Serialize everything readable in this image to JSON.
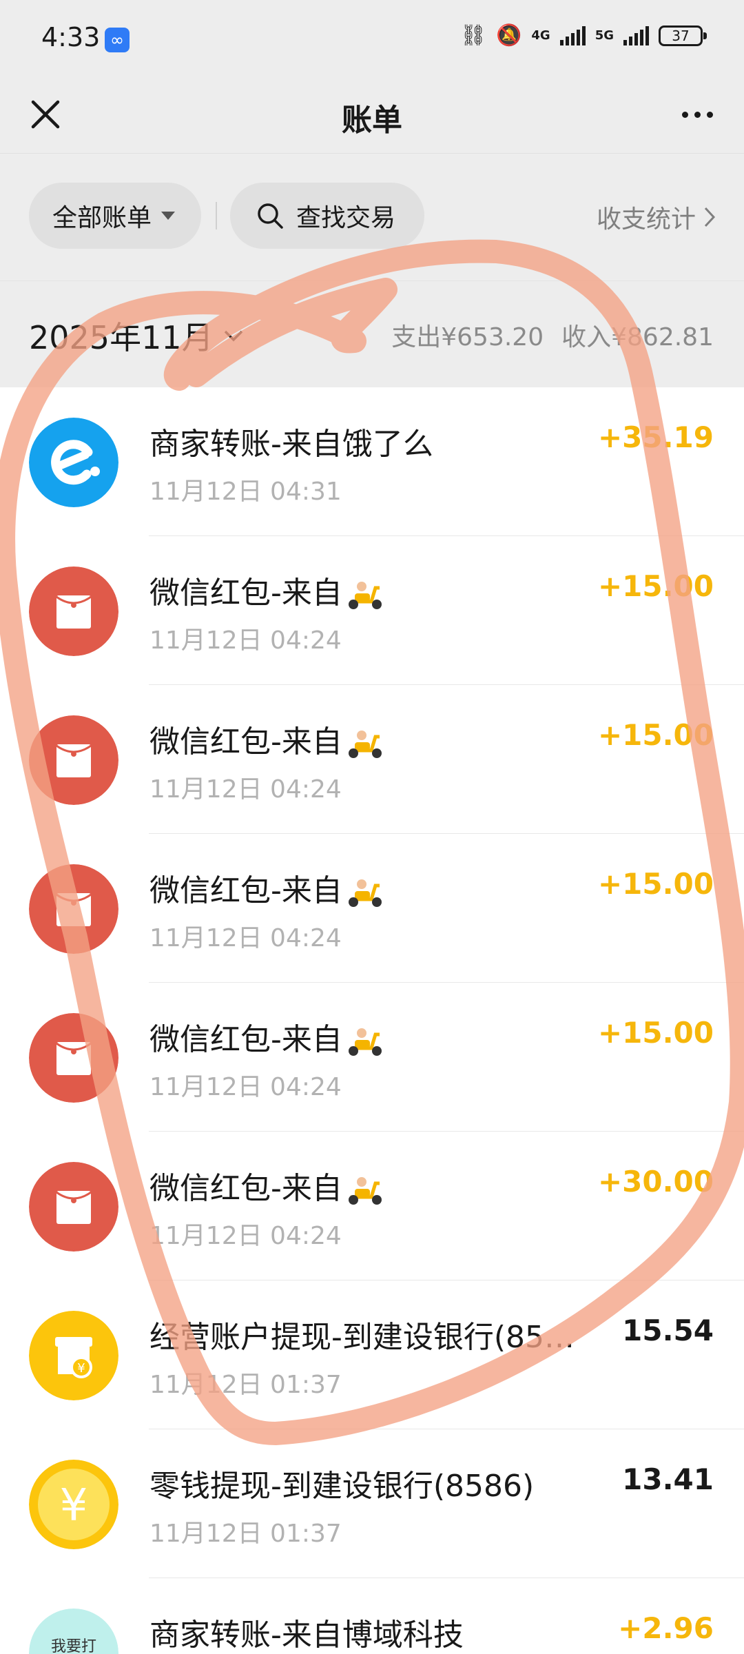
{
  "status_bar": {
    "time": "4:33",
    "battery": "37",
    "net1": "4G",
    "net2": "5G"
  },
  "nav": {
    "title": "账单"
  },
  "filters": {
    "all_bills": "全部账单",
    "search": "查找交易",
    "stats": "收支统计"
  },
  "month_bar": {
    "month": "2025年11月",
    "expense": "支出¥653.20",
    "income": "收入¥862.81"
  },
  "transactions": [
    {
      "title": "商家转账-来自饿了么",
      "time": "11月12日 04:31",
      "amount": "+35.19",
      "type": "income",
      "icon": "eleme-icon"
    },
    {
      "title": "微信红包-来自",
      "time": "11月12日 04:24",
      "amount": "+15.00",
      "type": "income",
      "icon": "red-packet-icon"
    },
    {
      "title": "微信红包-来自",
      "time": "11月12日 04:24",
      "amount": "+15.00",
      "type": "income",
      "icon": "red-packet-icon"
    },
    {
      "title": "微信红包-来自",
      "time": "11月12日 04:24",
      "amount": "+15.00",
      "type": "income",
      "icon": "red-packet-icon"
    },
    {
      "title": "微信红包-来自",
      "time": "11月12日 04:24",
      "amount": "+15.00",
      "type": "income",
      "icon": "red-packet-icon"
    },
    {
      "title": "微信红包-来自",
      "time": "11月12日 04:24",
      "amount": "+30.00",
      "type": "income",
      "icon": "red-packet-icon"
    },
    {
      "title": "经营账户提现-到建设银行(85…",
      "time": "11月12日 01:37",
      "amount": "15.54",
      "type": "expense",
      "icon": "business-account-icon"
    },
    {
      "title": "零钱提现-到建设银行(8586)",
      "time": "11月12日 01:37",
      "amount": "13.41",
      "type": "expense",
      "icon": "wallet-yuan-icon"
    },
    {
      "title": "商家转账-来自博域科技",
      "time": "",
      "amount": "+2.96",
      "type": "income",
      "icon": "merchant-icon"
    }
  ],
  "merchant_icon_text": "我要打",
  "colors": {
    "income": "#f6b60b",
    "red_packet": "#e05a4a",
    "eleme": "#15a2ee",
    "yellow_icon": "#fcc50c",
    "annotation_stroke": "#f4a184"
  }
}
